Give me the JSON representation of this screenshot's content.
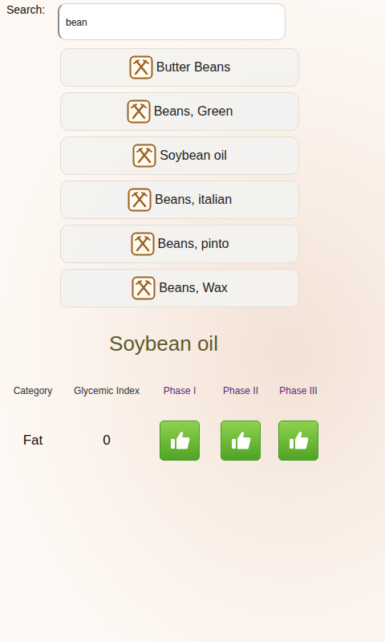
{
  "search": {
    "label": "Search:",
    "value": "bean"
  },
  "results": [
    {
      "name": "Butter Beans"
    },
    {
      "name": "Beans, Green"
    },
    {
      "name": "Soybean oil"
    },
    {
      "name": "Beans, italian"
    },
    {
      "name": "Beans, pinto"
    },
    {
      "name": "Beans, Wax"
    }
  ],
  "detail": {
    "title": "Soybean oil",
    "columns": [
      "Category",
      "Glycemic Index",
      "Phase I",
      "Phase II",
      "Phase III"
    ],
    "category": "Fat",
    "glycemic_index": "0",
    "phases": [
      {
        "name": "Phase I",
        "approved": true
      },
      {
        "name": "Phase II",
        "approved": true
      },
      {
        "name": "Phase III",
        "approved": true
      }
    ]
  }
}
